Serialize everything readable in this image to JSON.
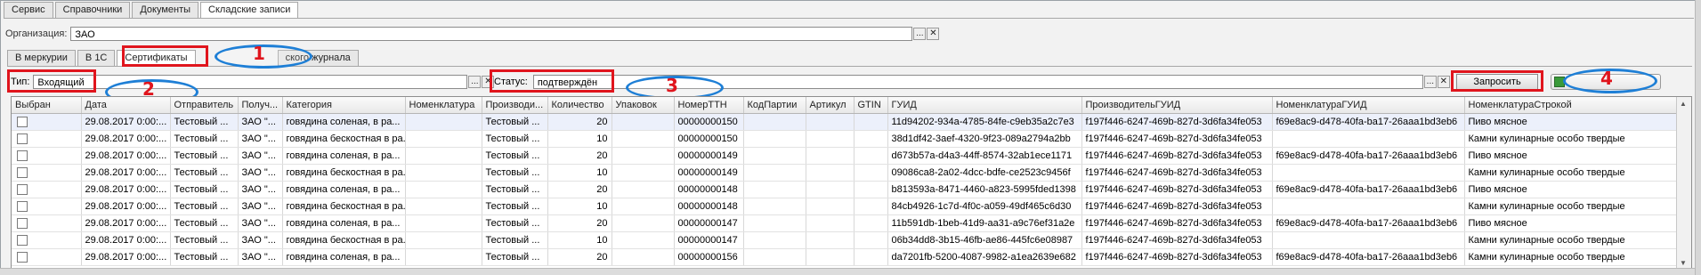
{
  "top_tabs": [
    "Сервис",
    "Справочники",
    "Документы",
    "Складские записи"
  ],
  "organization": {
    "label": "Организация:",
    "value": "ЗАО"
  },
  "sub_tabs": [
    "В меркурии",
    "В 1С",
    "Сертификаты",
    "ского журнала"
  ],
  "filter_type": {
    "label": "Тип:",
    "value": "Входящий"
  },
  "filter_status": {
    "label": "Статус:",
    "value": "подтверждён"
  },
  "request_button": "Запросить",
  "callouts": [
    "1",
    "2",
    "3",
    "4"
  ],
  "dots_glyph": "...",
  "clear_glyph": "✕",
  "grid": {
    "columns": [
      "Выбран",
      "Дата",
      "Отправитель",
      "Получ...",
      "Категория",
      "Номенклатура",
      "Производи...",
      "Количество",
      "Упаковок",
      "НомерТТН",
      "КодПартии",
      "Артикул",
      "GTIN",
      "ГУИД",
      "ПроизводительГУИД",
      "НоменклатураГУИД",
      "НоменклатураСтрокой"
    ],
    "rows": [
      [
        "",
        "29.08.2017 0:00:...",
        "Тестовый ...",
        "ЗАО \"...",
        "говядина соленая, в ра...",
        "",
        "Тестовый ...",
        "20",
        "",
        "00000000150",
        "",
        "",
        "",
        "11d94202-934a-4785-84fe-c9eb35a2c7e3",
        "f197f446-6247-469b-827d-3d6fa34fe053",
        "f69e8ac9-d478-40fa-ba17-26aaa1bd3eb6",
        "Пиво мясное"
      ],
      [
        "",
        "29.08.2017 0:00:...",
        "Тестовый ...",
        "ЗАО \"...",
        "говядина бескостная в ра...",
        "",
        "Тестовый ...",
        "10",
        "",
        "00000000150",
        "",
        "",
        "",
        "38d1df42-3aef-4320-9f23-089a2794a2bb",
        "f197f446-6247-469b-827d-3d6fa34fe053",
        "",
        "Камни кулинарные особо твердые"
      ],
      [
        "",
        "29.08.2017 0:00:...",
        "Тестовый ...",
        "ЗАО \"...",
        "говядина соленая, в ра...",
        "",
        "Тестовый ...",
        "20",
        "",
        "00000000149",
        "",
        "",
        "",
        "d673b57a-d4a3-44ff-8574-32ab1ece1171",
        "f197f446-6247-469b-827d-3d6fa34fe053",
        "f69e8ac9-d478-40fa-ba17-26aaa1bd3eb6",
        "Пиво мясное"
      ],
      [
        "",
        "29.08.2017 0:00:...",
        "Тестовый ...",
        "ЗАО \"...",
        "говядина бескостная в ра...",
        "",
        "Тестовый ...",
        "10",
        "",
        "00000000149",
        "",
        "",
        "",
        "09086ca8-2a02-4dcc-bdfe-ce2523c9456f",
        "f197f446-6247-469b-827d-3d6fa34fe053",
        "",
        "Камни кулинарные особо твердые"
      ],
      [
        "",
        "29.08.2017 0:00:...",
        "Тестовый ...",
        "ЗАО \"...",
        "говядина соленая, в ра...",
        "",
        "Тестовый ...",
        "20",
        "",
        "00000000148",
        "",
        "",
        "",
        "b813593a-8471-4460-a823-5995fded1398",
        "f197f446-6247-469b-827d-3d6fa34fe053",
        "f69e8ac9-d478-40fa-ba17-26aaa1bd3eb6",
        "Пиво мясное"
      ],
      [
        "",
        "29.08.2017 0:00:...",
        "Тестовый ...",
        "ЗАО \"...",
        "говядина бескостная в ра...",
        "",
        "Тестовый ...",
        "10",
        "",
        "00000000148",
        "",
        "",
        "",
        "84cb4926-1c7d-4f0c-a059-49df465c6d30",
        "f197f446-6247-469b-827d-3d6fa34fe053",
        "",
        "Камни кулинарные особо твердые"
      ],
      [
        "",
        "29.08.2017 0:00:...",
        "Тестовый ...",
        "ЗАО \"...",
        "говядина соленая, в ра...",
        "",
        "Тестовый ...",
        "20",
        "",
        "00000000147",
        "",
        "",
        "",
        "11b591db-1beb-41d9-aa31-a9c76ef31a2e",
        "f197f446-6247-469b-827d-3d6fa34fe053",
        "f69e8ac9-d478-40fa-ba17-26aaa1bd3eb6",
        "Пиво мясное"
      ],
      [
        "",
        "29.08.2017 0:00:...",
        "Тестовый ...",
        "ЗАО \"...",
        "говядина бескостная в ра...",
        "",
        "Тестовый ...",
        "10",
        "",
        "00000000147",
        "",
        "",
        "",
        "06b34dd8-3b15-46fb-ae86-445fc6e08987",
        "f197f446-6247-469b-827d-3d6fa34fe053",
        "",
        "Камни кулинарные особо твердые"
      ],
      [
        "",
        "29.08.2017 0:00:...",
        "Тестовый ...",
        "ЗАО \"...",
        "говядина соленая, в ра...",
        "",
        "Тестовый ...",
        "20",
        "",
        "00000000156",
        "",
        "",
        "",
        "da7201fb-5200-4087-9982-a1ea2639e682",
        "f197f446-6247-469b-827d-3d6fa34fe053",
        "f69e8ac9-d478-40fa-ba17-26aaa1bd3eb6",
        "Камни кулинарные особо твердые"
      ]
    ]
  },
  "colors": {
    "highlight_red": "#e0151d",
    "callout_blue": "#1e7fd6",
    "selected_row": "#ecf0fb"
  }
}
